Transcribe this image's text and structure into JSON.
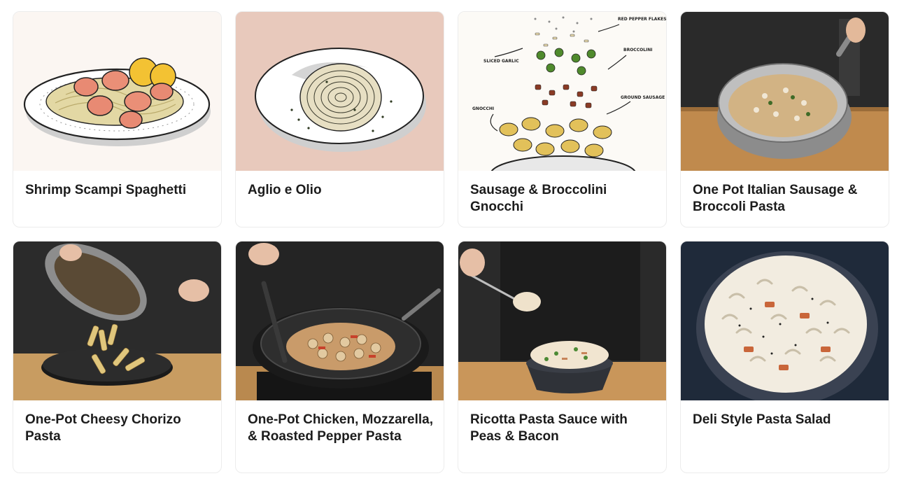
{
  "recipes": [
    {
      "title": "Shrimp Scampi Spaghetti",
      "image": "shrimp-scampi-illustration",
      "background": "#fbf6f2"
    },
    {
      "title": "Aglio e Olio",
      "image": "aglio-e-olio-illustration",
      "background": "#e8c9bc"
    },
    {
      "title": "Sausage & Broccolini Gnocchi",
      "image": "sausage-broccolini-gnocchi-diagram",
      "background": "#fcfaf6",
      "annotations": [
        "RED PEPPER FLAKES",
        "SLICED GARLIC",
        "BROCCOLINI",
        "GROUND SAUSAGE",
        "GNOCCHI"
      ]
    },
    {
      "title": "One Pot Italian Sausage & Broccoli Pasta",
      "image": "sausage-broccoli-pasta-photo",
      "background": "#2a2a2a"
    },
    {
      "title": "One-Pot Cheesy Chorizo Pasta",
      "image": "chorizo-pasta-photo",
      "background": "#2b2b2b"
    },
    {
      "title": "One-Pot Chicken, Mozzarella, & Roasted Pepper Pasta",
      "image": "chicken-mozzarella-pasta-photo",
      "background": "#242424"
    },
    {
      "title": "Ricotta Pasta Sauce with Peas & Bacon",
      "image": "ricotta-pasta-photo",
      "background": "#2a2a2a"
    },
    {
      "title": "Deli Style Pasta Salad",
      "image": "pasta-salad-photo",
      "background": "#1f2a3a"
    }
  ]
}
